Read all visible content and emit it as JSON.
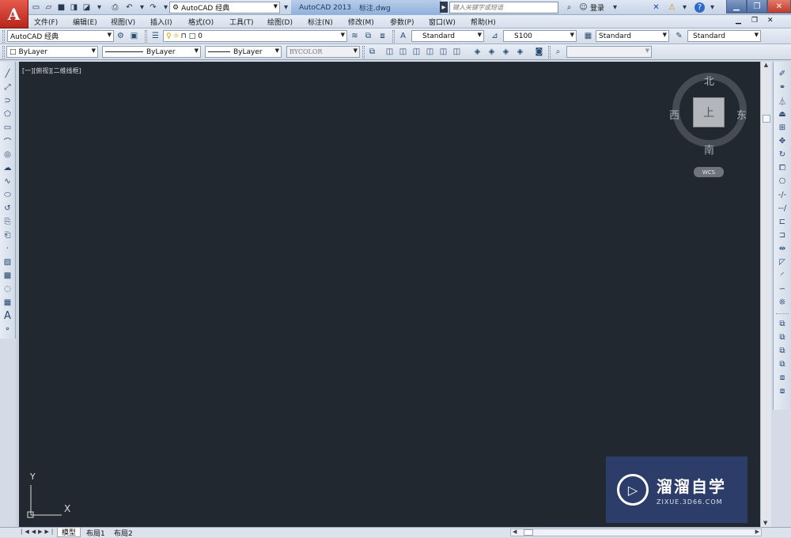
{
  "app": {
    "title": "AutoCAD 2013",
    "filename": "标注.dwg",
    "logo_letter": "A"
  },
  "quick_access": {
    "workspace": "AutoCAD 经典"
  },
  "search": {
    "placeholder": "键入关键字或短语"
  },
  "account": {
    "login": "登录"
  },
  "menus": [
    "文件(F)",
    "编辑(E)",
    "视图(V)",
    "插入(I)",
    "格式(O)",
    "工具(T)",
    "绘图(D)",
    "标注(N)",
    "修改(M)",
    "参数(P)",
    "窗口(W)",
    "帮助(H)"
  ],
  "toolbar1": {
    "workspace": "AutoCAD 经典",
    "layer": "0",
    "text_style": "Standard",
    "dim_style": "S100",
    "table_style": "Standard",
    "mleader_style": "Standard"
  },
  "toolbar2": {
    "color": "ByLayer",
    "linetype": "ByLayer",
    "lineweight": "ByLayer",
    "plotstyle": "BYCOLOR"
  },
  "viewport": {
    "label": "[一][俯视][二维线框]"
  },
  "viewcube": {
    "north": "北",
    "south": "南",
    "east": "东",
    "west": "西",
    "face": "上",
    "wcs": "WCS"
  },
  "ucs": {
    "x": "X",
    "y": "Y"
  },
  "tabs": [
    "模型",
    "布局1",
    "布局2"
  ],
  "watermark": {
    "name": "溜溜自学",
    "url": "ZIXUE.3D66.COM"
  },
  "colors": {
    "canvas": "#212830",
    "accent": "#c4271c",
    "logo_bg": "#2b3d68"
  }
}
